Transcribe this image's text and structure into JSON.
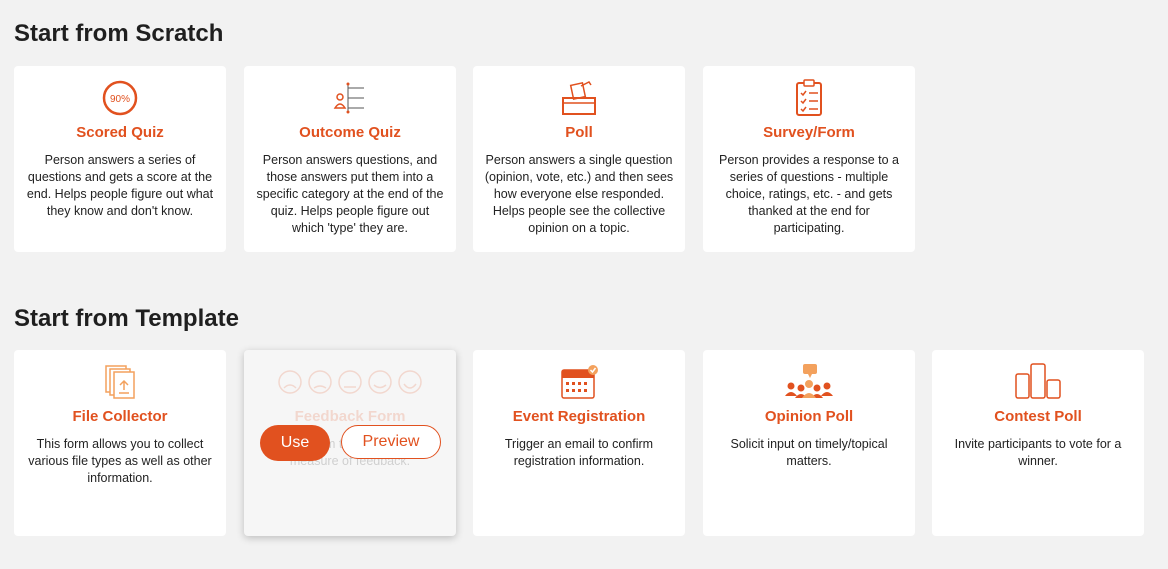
{
  "scratch": {
    "heading": "Start from Scratch",
    "cards": [
      {
        "title": "Scored Quiz",
        "desc": "Person answers a series of questions and gets a score at the end. Helps people figure out what they know and don't know.",
        "icon": "percent-circle-icon",
        "icon_text": "90%"
      },
      {
        "title": "Outcome Quiz",
        "desc": "Person answers questions, and those answers put them into a specific category at the end of the quiz. Helps people figure out which 'type' they are.",
        "icon": "person-branches-icon"
      },
      {
        "title": "Poll",
        "desc": "Person answers a single question (opinion, vote, etc.) and then sees how everyone else responded. Helps people see the collective opinion on a topic.",
        "icon": "ballot-box-icon"
      },
      {
        "title": "Survey/Form",
        "desc": "Person provides a response to a series of questions - multiple choice, ratings, etc. - and gets thanked at the end for participating.",
        "icon": "clipboard-checklist-icon"
      }
    ]
  },
  "template": {
    "heading": "Start from Template",
    "cards": [
      {
        "title": "File Collector",
        "desc": "This form allows you to collect various file types as well as other information.",
        "icon": "file-upload-icon"
      },
      {
        "title": "Feedback Form",
        "desc": "Use this form to collect a simple measure of feedback.",
        "icon": "rating-faces-icon"
      },
      {
        "title": "Event Registration",
        "desc": "Trigger an email to confirm registration information.",
        "icon": "calendar-check-icon"
      },
      {
        "title": "Opinion Poll",
        "desc": "Solicit input on timely/topical matters.",
        "icon": "group-chat-icon"
      },
      {
        "title": "Contest Poll",
        "desc": "Invite participants to vote for a winner.",
        "icon": "phones-contest-icon"
      }
    ],
    "hover_actions": {
      "use_label": "Use",
      "preview_label": "Preview"
    }
  },
  "colors": {
    "accent": "#e1511f",
    "accent_light": "#f3a15d",
    "background": "#f2f2f2",
    "card": "#ffffff"
  }
}
